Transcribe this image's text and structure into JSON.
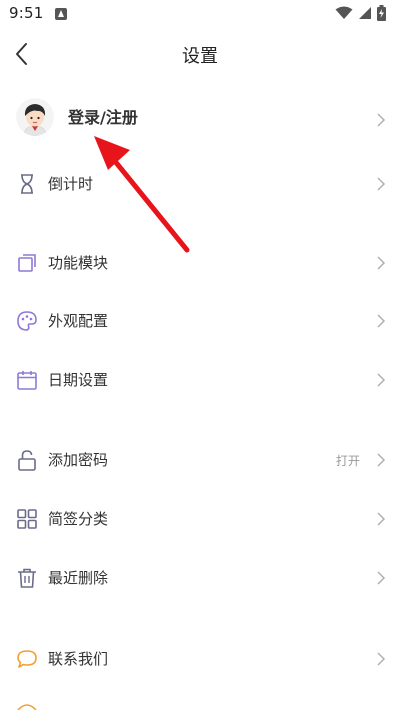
{
  "status_bar": {
    "time": "9:51",
    "icons": [
      "notification-a-icon",
      "wifi-icon",
      "signal-icon",
      "battery-charging-icon"
    ]
  },
  "header": {
    "title": "设置",
    "back_icon": "chevron-left-icon"
  },
  "login": {
    "label": "登录/注册",
    "avatar": "cartoon-avatar"
  },
  "items": [
    {
      "label": "倒计时",
      "icon": "hourglass-icon"
    },
    {
      "label": "功能模块",
      "icon": "layers-icon"
    },
    {
      "label": "外观配置",
      "icon": "palette-icon"
    },
    {
      "label": "日期设置",
      "icon": "calendar-icon"
    },
    {
      "label": "添加密码",
      "icon": "lock-icon",
      "value": "打开"
    },
    {
      "label": "简签分类",
      "icon": "grid-icon"
    },
    {
      "label": "最近删除",
      "icon": "trash-icon"
    },
    {
      "label": "联系我们",
      "icon": "chat-bubble-icon"
    }
  ],
  "colors": {
    "accent_purple": "#8e79d8",
    "icon_gray": "#6b6b8a",
    "chevron": "#b0b0b0",
    "annotation_red": "#e8141c",
    "contact_orange": "#f0a030"
  }
}
